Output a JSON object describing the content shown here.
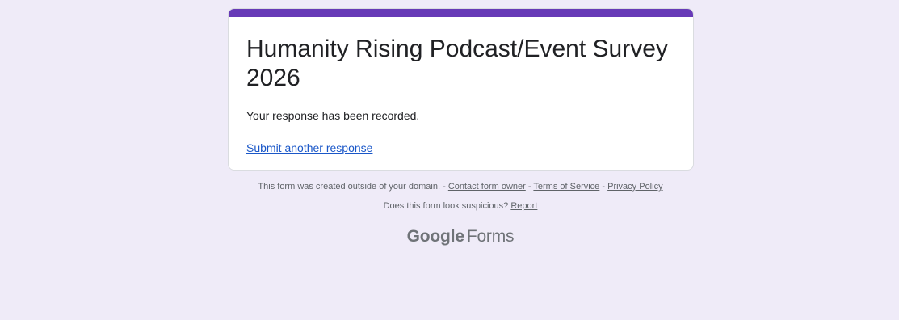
{
  "form": {
    "title": "Humanity Rising Podcast/Event Survey 2026",
    "confirmation_message": "Your response has been recorded.",
    "submit_another_link": "Submit another response",
    "accent_color": "#673ab7"
  },
  "footer": {
    "notice": "This form was created outside of your domain. -",
    "contact_owner_link": "Contact form owner",
    "separator_1": "-",
    "terms_link": "Terms of Service",
    "separator_2": "-",
    "privacy_link": "Privacy Policy",
    "suspicious_text": "Does this form look suspicious?",
    "report_link": "Report"
  },
  "branding": {
    "google": "Google",
    "forms": "Forms"
  },
  "colors": {
    "background": "#efebf8",
    "card": "#ffffff",
    "link": "#1a57c8"
  }
}
